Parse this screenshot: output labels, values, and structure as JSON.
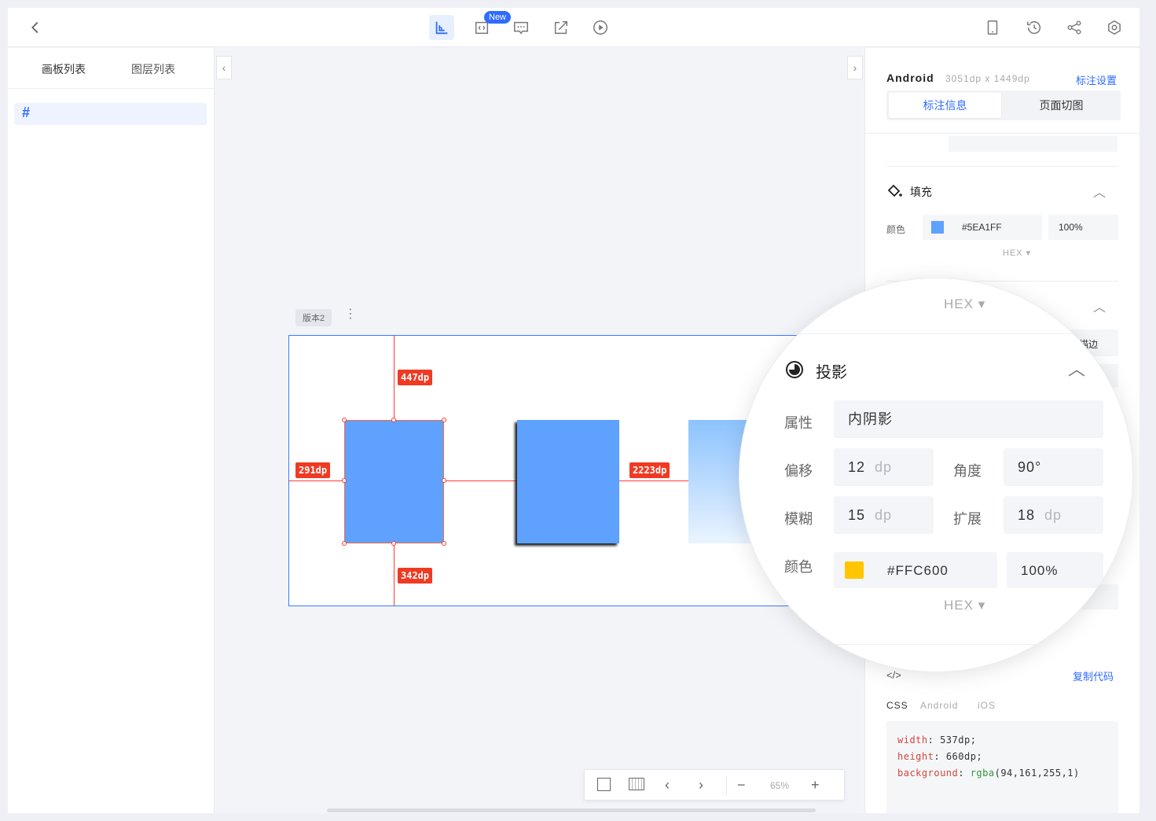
{
  "toolbar": {
    "new_badge": "New"
  },
  "left": {
    "tab_artboards": "画板列表",
    "tab_layers": "图层列表",
    "artboard_icon": "#"
  },
  "canvas": {
    "version_label": "版本2",
    "measure_top": "447dp",
    "measure_left": "291dp",
    "measure_bottom": "342dp",
    "measure_right": "2223dp",
    "zoom": "65%"
  },
  "panel": {
    "platform": "Android",
    "dimensions": "3051dp x 1449dp",
    "settings_link": "标注设置",
    "tab_info": "标注信息",
    "tab_slices": "页面切图",
    "fill_title": "填充",
    "fill_color_label": "颜色",
    "fill_hex": "#5EA1FF",
    "fill_opacity": "100%",
    "hex_label": "HEX",
    "stroke_partial": "描边",
    "copy_code": "复制代码",
    "code_tabs": [
      "CSS",
      "Android",
      "iOS"
    ],
    "code": [
      {
        "key": "width",
        "value": "537dp;"
      },
      {
        "key": "height",
        "value": "660dp;"
      },
      {
        "key": "background",
        "func": "rgba",
        "value": "(94,161,255,1)"
      }
    ]
  },
  "magnifier": {
    "hex_top": "HEX",
    "shadow_title": "投影",
    "attr_label": "属性",
    "attr_value": "内阴影",
    "offset_label": "偏移",
    "offset_value": "12",
    "angle_label": "角度",
    "angle_value": "90°",
    "blur_label": "模糊",
    "blur_value": "15",
    "spread_label": "扩展",
    "spread_value": "18",
    "unit": "dp",
    "color_label": "颜色",
    "color_hex": "#FFC600",
    "color_opacity": "100%",
    "hex_bottom": "HEX"
  },
  "colors": {
    "accent": "#2f6bff",
    "fill": "#5EA1FF",
    "shadow_color": "#FFC600",
    "measure": "#f03a23"
  }
}
